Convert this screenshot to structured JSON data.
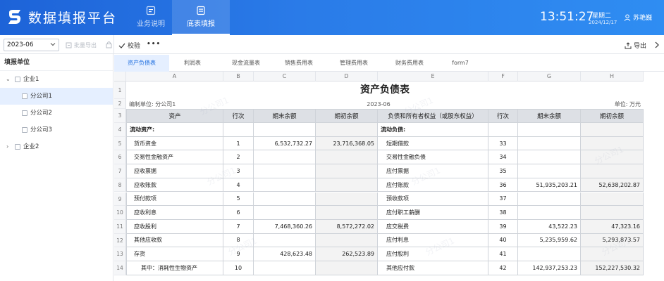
{
  "header": {
    "app_title": "数据填报平台",
    "nav": [
      {
        "label": "业务说明",
        "active": false
      },
      {
        "label": "底表填报",
        "active": true
      }
    ],
    "time": "13:51:27",
    "weekday": "星期二",
    "date": "2024/12/17",
    "user": "苏艳巍"
  },
  "toolbar": {
    "period_value": "2023-06",
    "batch_export_label": "批量导出",
    "validate_label": "校验",
    "more_label": "•••",
    "export_label": "导出"
  },
  "sidebar": {
    "title": "填报单位",
    "nodes": [
      {
        "label": "企业1",
        "level": 0,
        "expanded": true,
        "selected": false
      },
      {
        "label": "分公司1",
        "level": 1,
        "selected": true
      },
      {
        "label": "分公司2",
        "level": 1,
        "selected": false
      },
      {
        "label": "分公司3",
        "level": 1,
        "selected": false
      },
      {
        "label": "企业2",
        "level": 0,
        "expanded": false,
        "selected": false
      }
    ]
  },
  "tabs": [
    "资产负债表",
    "利润表",
    "现金流量表",
    "销售费用表",
    "管理费用表",
    "财务费用表",
    "form7"
  ],
  "active_tab": 0,
  "sheet": {
    "col_letters": [
      "A",
      "B",
      "C",
      "D",
      "E",
      "F",
      "G",
      "H"
    ],
    "title": "资产负债表",
    "unit_prefix": "编制单位:",
    "unit_name": "分公司1",
    "period": "2023-06",
    "money_unit": "单位: 万元",
    "headers": [
      "资产",
      "行次",
      "期末余额",
      "期初余额",
      "负债和所有者权益（或股东权益）",
      "行次",
      "期末余额",
      "期初余额"
    ],
    "rows": [
      {
        "n": "5",
        "a": "流动资产:",
        "b": "",
        "c": "",
        "d": "",
        "e": "流动负债:",
        "f": "",
        "g": "",
        "h": ""
      },
      {
        "n": "5",
        "a": "货币资金",
        "b": "1",
        "c": "6,532,732.27",
        "d": "23,716,368.05",
        "e": "短期借款",
        "f": "33",
        "g": "",
        "h": ""
      },
      {
        "n": "6",
        "a": "交易性金融资产",
        "b": "2",
        "c": "",
        "d": "",
        "e": "交易性金融负债",
        "f": "34",
        "g": "",
        "h": ""
      },
      {
        "n": "7",
        "a": "应收票据",
        "b": "3",
        "c": "",
        "d": "",
        "e": "应付票据",
        "f": "35",
        "g": "",
        "h": ""
      },
      {
        "n": "8",
        "a": "应收账款",
        "b": "4",
        "c": "",
        "d": "",
        "e": "应付账款",
        "f": "36",
        "g": "51,935,203.21",
        "h": "52,638,202.87"
      },
      {
        "n": "9",
        "a": "预付款项",
        "b": "5",
        "c": "",
        "d": "",
        "e": "预收款项",
        "f": "37",
        "g": "",
        "h": ""
      },
      {
        "n": "10",
        "a": "应收利息",
        "b": "6",
        "c": "",
        "d": "",
        "e": "应付职工薪酬",
        "f": "38",
        "g": "",
        "h": ""
      },
      {
        "n": "11",
        "a": "应收股利",
        "b": "7",
        "c": "7,468,360.26",
        "d": "8,572,272.02",
        "e": "应交税费",
        "f": "39",
        "g": "43,522.23",
        "h": "47,323.16"
      },
      {
        "n": "12",
        "a": "其他应收款",
        "b": "8",
        "c": "",
        "d": "",
        "e": "应付利息",
        "f": "40",
        "g": "5,235,959.62",
        "h": "5,293,873.57"
      },
      {
        "n": "13",
        "a": "存货",
        "b": "9",
        "c": "428,623.48",
        "d": "262,523.89",
        "e": "应付股利",
        "f": "41",
        "g": "",
        "h": ""
      },
      {
        "n": "14",
        "a": "其中：消耗性生物资产",
        "b": "10",
        "c": "",
        "d": "",
        "e": "其他应付款",
        "f": "42",
        "g": "142,937,253.23",
        "h": "152,227,530.32"
      }
    ]
  },
  "colors": {
    "header_blue": "#2a7be8",
    "active_tab_bg": "#e5efff",
    "active_tab_text": "#1f6fe0",
    "table_header_bg": "#dde0e5"
  },
  "icons": [
    "logo-icon",
    "info-icon",
    "table-icon",
    "user-icon",
    "chevron-down-icon",
    "export-icon",
    "lock-icon",
    "check-icon",
    "more-icon",
    "chevron-right-icon"
  ]
}
